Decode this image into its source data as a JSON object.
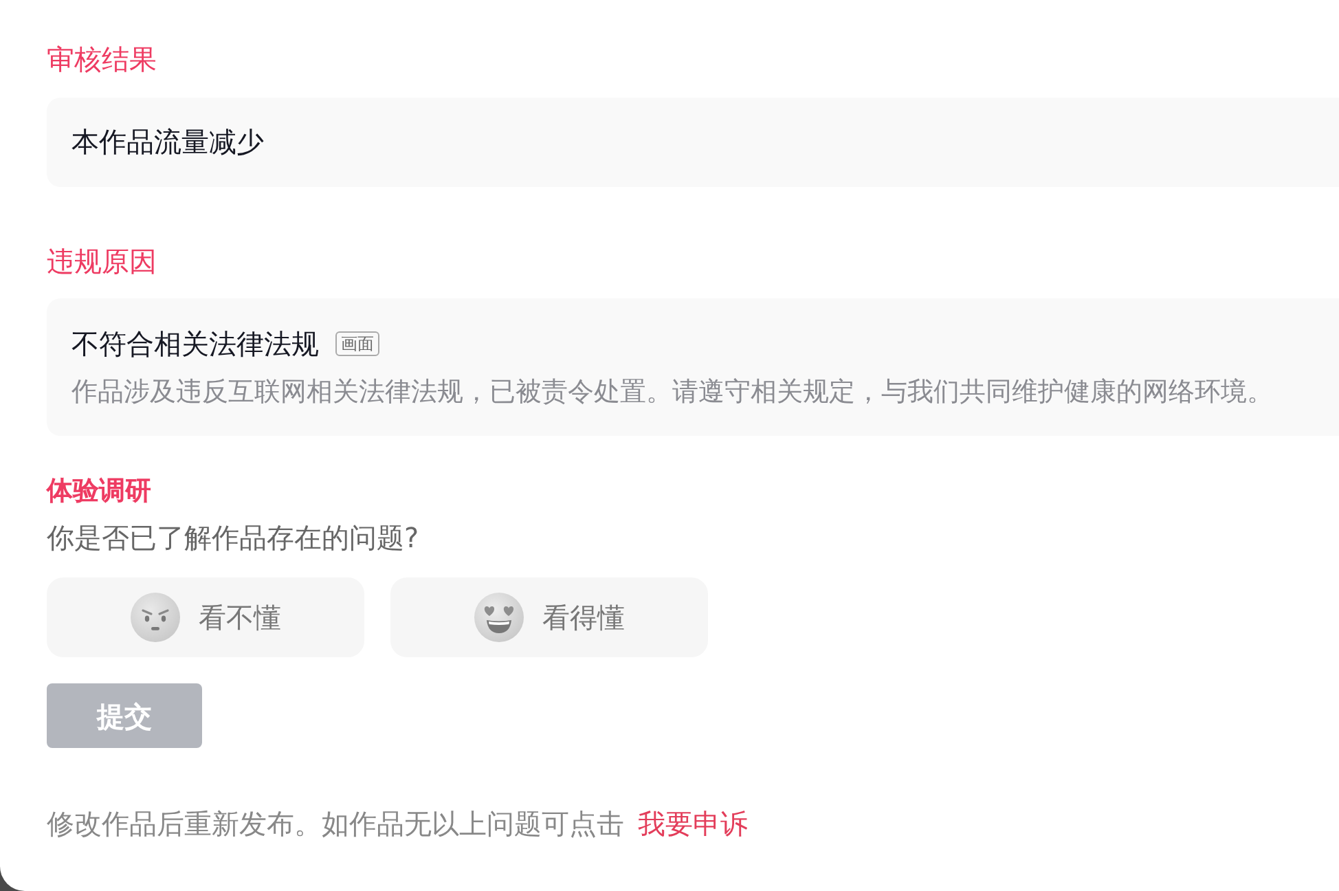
{
  "sections": [
    {
      "kind": "result",
      "title": "审核结果",
      "text": "本作品流量减少"
    },
    {
      "kind": "reason",
      "title": "违规原因",
      "reason_title": "不符合相关法律法规",
      "tag": "画面",
      "description": "作品涉及违反互联网相关法律法规，已被责令处置。请遵守相关规定，与我们共同维护健康的网络环境。"
    }
  ],
  "survey": {
    "title": "体验调研",
    "question": "你是否已了解作品存在的问题?",
    "options": [
      {
        "label": "看不懂",
        "kind": "confused",
        "selected": false
      },
      {
        "label": "看得懂",
        "kind": "happy",
        "selected": false
      }
    ],
    "submit": {
      "label": "提交",
      "disabled": true
    }
  },
  "footer": {
    "text": "修改作品后重新发布。如作品无以上问题可点击",
    "link": "我要申诉"
  }
}
